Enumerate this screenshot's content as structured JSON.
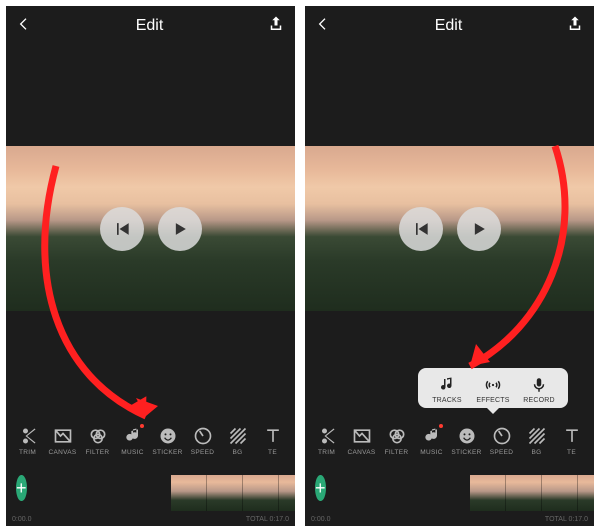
{
  "header": {
    "title": "Edit"
  },
  "toolbar": {
    "items": [
      {
        "label": "TRIM"
      },
      {
        "label": "CANVAS"
      },
      {
        "label": "FILTER"
      },
      {
        "label": "MUSIC"
      },
      {
        "label": "STICKER"
      },
      {
        "label": "SPEED"
      },
      {
        "label": "BG"
      },
      {
        "label": "TE"
      }
    ]
  },
  "popup": {
    "tracks": "TRACKS",
    "effects": "EFFECTS",
    "record": "RECORD"
  },
  "timeline": {
    "current": "0:00.0",
    "total_prefix": "TOTAL",
    "total": "0:17.0"
  }
}
